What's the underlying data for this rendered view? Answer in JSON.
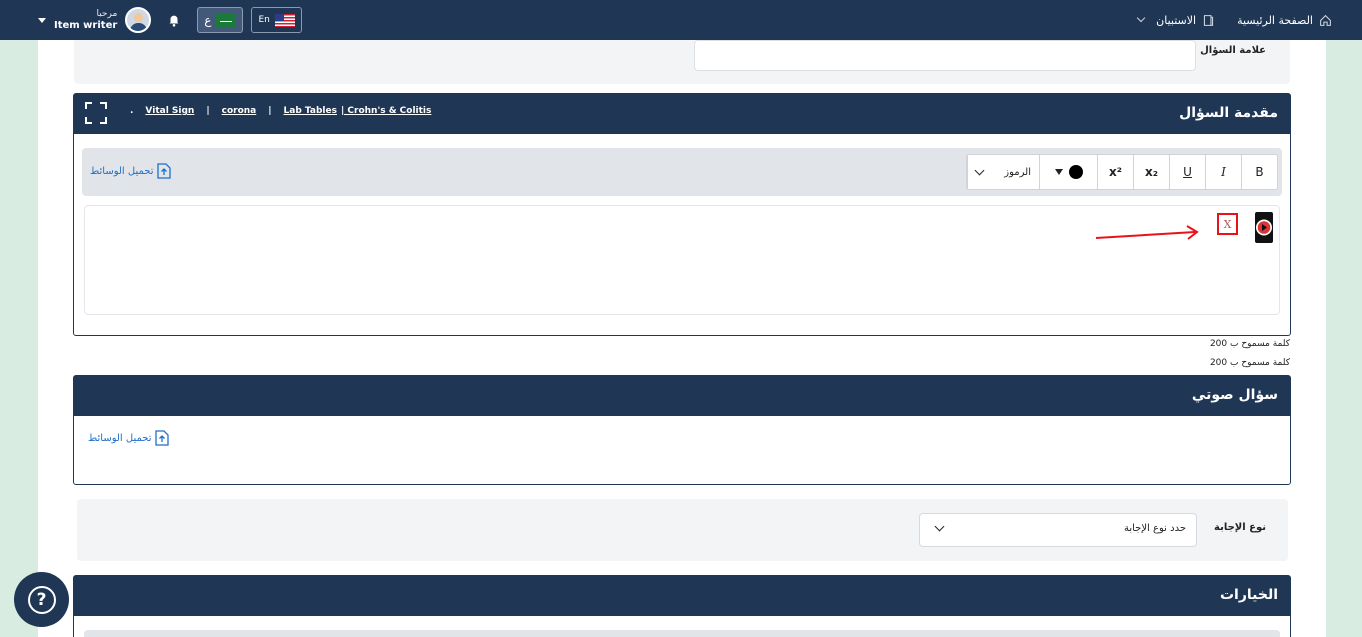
{
  "topbar": {
    "home_label": "الصفحة الرئيسية",
    "surveys_label": "الاستبيان",
    "greeting": "مرحبا",
    "role": "Item writer",
    "lang_ar": "ع",
    "lang_en": "En"
  },
  "question_mark": {
    "label": "علامة السؤال",
    "value": ""
  },
  "intro_card": {
    "title": "مقدمة السؤال",
    "links": [
      ".",
      "Vital Sign",
      "|",
      "corona",
      "|",
      "Lab Tables",
      "| Crohn's & Colitis"
    ]
  },
  "toolbar": {
    "bold": "B",
    "italic": "I",
    "underline": "U",
    "subscript": "x₂",
    "superscript": "x²",
    "symbols": "الرموز",
    "text_color": "#000000"
  },
  "upload_label": "تحميل الوسائط",
  "editor": {
    "broken_image_glyph": "X"
  },
  "word_limit_notes": [
    "200 كلمة مسموح ب",
    "200 كلمة مسموح ب"
  ],
  "audio_card": {
    "title": "سؤال صوتي",
    "upload_label": "تحميل الوسائط"
  },
  "answer_type": {
    "label": "نوع الإجابة",
    "placeholder": "حدد نوع الإجابة"
  },
  "options_card": {
    "title": "الخيارات"
  },
  "help": {
    "glyph": "?"
  },
  "colors": {
    "navy": "#1f3655",
    "annotation_red": "#e8121b",
    "link_blue": "#1f6fc9"
  }
}
